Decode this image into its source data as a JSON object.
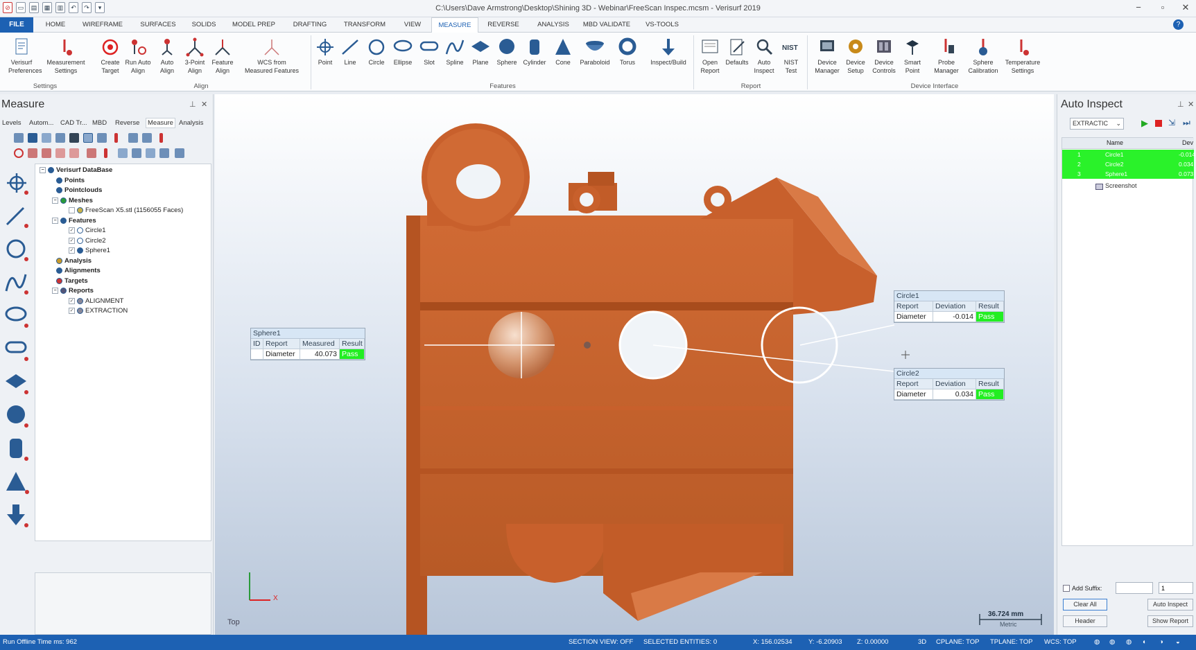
{
  "window": {
    "title": "C:\\Users\\Dave Armstrong\\Desktop\\Shining 3D - Webinar\\FreeScan Inspec.mcsm - Verisurf 2019"
  },
  "menu": {
    "file": "FILE",
    "tabs": [
      "HOME",
      "WIREFRAME",
      "SURFACES",
      "SOLIDS",
      "MODEL PREP",
      "DRAFTING",
      "TRANSFORM",
      "VIEW",
      "MEASURE",
      "REVERSE",
      "ANALYSIS",
      "MBD VALIDATE",
      "VS-TOOLS"
    ]
  },
  "ribbon": {
    "buttons": [
      {
        "l1": "Verisurf",
        "l2": "Preferences",
        "icon": "preferences-icon"
      },
      {
        "l1": "Measurement",
        "l2": "Settings",
        "icon": "measurement-settings-icon"
      },
      {
        "l1": "Create",
        "l2": "Target",
        "icon": "target-icon"
      },
      {
        "l1": "Run Auto",
        "l2": "Align",
        "icon": "run-auto-align-icon"
      },
      {
        "l1": "Auto",
        "l2": "Align",
        "icon": "auto-align-icon"
      },
      {
        "l1": "3-Point",
        "l2": "Align",
        "icon": "three-point-align-icon"
      },
      {
        "l1": "Feature",
        "l2": "Align",
        "icon": "feature-align-icon"
      },
      {
        "l1": "WCS from",
        "l2": "Measured Features",
        "icon": "wcs-icon"
      },
      {
        "l1": "Point",
        "l2": "",
        "icon": "point-icon"
      },
      {
        "l1": "Line",
        "l2": "",
        "icon": "line-icon"
      },
      {
        "l1": "Circle",
        "l2": "",
        "icon": "circle-icon"
      },
      {
        "l1": "Ellipse",
        "l2": "",
        "icon": "ellipse-icon"
      },
      {
        "l1": "Slot",
        "l2": "",
        "icon": "slot-icon"
      },
      {
        "l1": "Spline",
        "l2": "",
        "icon": "spline-icon"
      },
      {
        "l1": "Plane",
        "l2": "",
        "icon": "plane-icon"
      },
      {
        "l1": "Sphere",
        "l2": "",
        "icon": "sphere-icon"
      },
      {
        "l1": "Cylinder",
        "l2": "",
        "icon": "cylinder-icon"
      },
      {
        "l1": "Cone",
        "l2": "",
        "icon": "cone-icon"
      },
      {
        "l1": "Paraboloid",
        "l2": "",
        "icon": "paraboloid-icon"
      },
      {
        "l1": "Torus",
        "l2": "",
        "icon": "torus-icon"
      },
      {
        "l1": "Inspect/Build",
        "l2": "",
        "icon": "inspect-build-icon"
      },
      {
        "l1": "Open",
        "l2": "Report",
        "icon": "open-report-icon"
      },
      {
        "l1": "Defaults",
        "l2": "",
        "icon": "defaults-icon"
      },
      {
        "l1": "Auto",
        "l2": "Inspect",
        "icon": "auto-inspect-icon"
      },
      {
        "l1": "NIST",
        "l2": "Test",
        "icon": "nist-test-icon"
      },
      {
        "l1": "Device",
        "l2": "Manager",
        "icon": "device-manager-icon"
      },
      {
        "l1": "Device",
        "l2": "Setup",
        "icon": "device-setup-icon"
      },
      {
        "l1": "Device",
        "l2": "Controls",
        "icon": "device-controls-icon"
      },
      {
        "l1": "Smart",
        "l2": "Point",
        "icon": "smart-point-icon"
      },
      {
        "l1": "Probe",
        "l2": "Manager",
        "icon": "probe-manager-icon"
      },
      {
        "l1": "Sphere",
        "l2": "Calibration",
        "icon": "sphere-calibration-icon"
      },
      {
        "l1": "Temperature",
        "l2": "Settings",
        "icon": "temperature-settings-icon"
      }
    ],
    "groups": [
      "Settings",
      "Align",
      "Features",
      "Report",
      "Device Interface"
    ]
  },
  "left_panel": {
    "title": "Measure",
    "tabs": [
      "Levels",
      "Autom...",
      "CAD Tr...",
      "MBD",
      "Reverse",
      "Measure",
      "Analysis"
    ],
    "active_tab": "Measure",
    "tree": [
      {
        "label": "Verisurf DataBase",
        "bold": true,
        "box": "−",
        "icon": "database-icon"
      },
      {
        "label": "Points",
        "bold": true,
        "icon": "points-icon"
      },
      {
        "label": "Pointclouds",
        "bold": true,
        "icon": "pointclouds-icon"
      },
      {
        "label": "Meshes",
        "bold": true,
        "box": "−",
        "icon": "meshes-icon"
      },
      {
        "label": "FreeScan X5.stl (1156055 Faces)",
        "bold": false,
        "box": "",
        "icon": "mesh-file-icon"
      },
      {
        "label": "Features",
        "bold": true,
        "box": "−",
        "icon": "features-icon"
      },
      {
        "label": "Circle1",
        "bold": false,
        "box": "✓",
        "icon": "circle-feature-icon"
      },
      {
        "label": "Circle2",
        "bold": false,
        "box": "✓",
        "icon": "circle-feature-icon"
      },
      {
        "label": "Sphere1",
        "bold": false,
        "box": "✓",
        "icon": "sphere-feature-icon"
      },
      {
        "label": "Analysis",
        "bold": true,
        "icon": "analysis-icon"
      },
      {
        "label": "Alignments",
        "bold": true,
        "icon": "alignments-icon"
      },
      {
        "label": "Targets",
        "bold": true,
        "icon": "targets-icon"
      },
      {
        "label": "Reports",
        "bold": true,
        "box": "−",
        "icon": "reports-icon"
      },
      {
        "label": "ALIGNMENT",
        "bold": false,
        "box": "✓",
        "icon": "report-item-icon"
      },
      {
        "label": "EXTRACTION",
        "bold": false,
        "box": "✓",
        "icon": "report-item-icon"
      }
    ]
  },
  "viewport": {
    "view_label": "Top",
    "axis_x": "X",
    "scale_value": "36.724 mm",
    "scale_unit": "Metric",
    "sphere1": {
      "title": "Sphere1",
      "headers": [
        "ID",
        "Report",
        "Measured",
        "Result"
      ],
      "row": [
        "",
        "Diameter",
        "40.073",
        "Pass"
      ]
    },
    "circle1": {
      "title": "Circle1",
      "headers": [
        "Report",
        "Deviation",
        "Result"
      ],
      "row": [
        "Diameter",
        "-0.014",
        "Pass"
      ]
    },
    "circle2": {
      "title": "Circle2",
      "headers": [
        "Report",
        "Deviation",
        "Result"
      ],
      "row": [
        "Diameter",
        "0.034",
        "Pass"
      ]
    }
  },
  "right_panel": {
    "title": "Auto Inspect",
    "select_value": "EXTRACTIC",
    "columns": [
      "Name",
      "Dev"
    ],
    "rows": [
      {
        "num": "1",
        "name": "Circle1",
        "dev": "-0.014"
      },
      {
        "num": "2",
        "name": "Circle2",
        "dev": "0.034"
      },
      {
        "num": "3",
        "name": "Sphere1",
        "dev": "0.073"
      }
    ],
    "extra_item": "Screenshot",
    "add_suffix_label": "Add Suffix:",
    "suffix_value": "",
    "suffix_number": "1",
    "clear_all": "Clear All",
    "auto_inspect": "Auto Inspect",
    "header": "Header",
    "show_report": "Show Report"
  },
  "status": {
    "left": "Run Offline Time ms: 962",
    "section_view": "SECTION VIEW: OFF",
    "selected": "SELECTED ENTITIES: 0",
    "x": "X:  156.02534",
    "y": "Y:  -6.20903",
    "z": "Z:  0.00000",
    "mode": "3D",
    "cplane": "CPLANE: TOP",
    "tplane": "TPLANE: TOP",
    "wcs": "WCS: TOP"
  },
  "colors": {
    "accent": "#1d61b3",
    "part": "#c8602c",
    "pass": "#22ee22",
    "highlight": "#2af22a"
  }
}
